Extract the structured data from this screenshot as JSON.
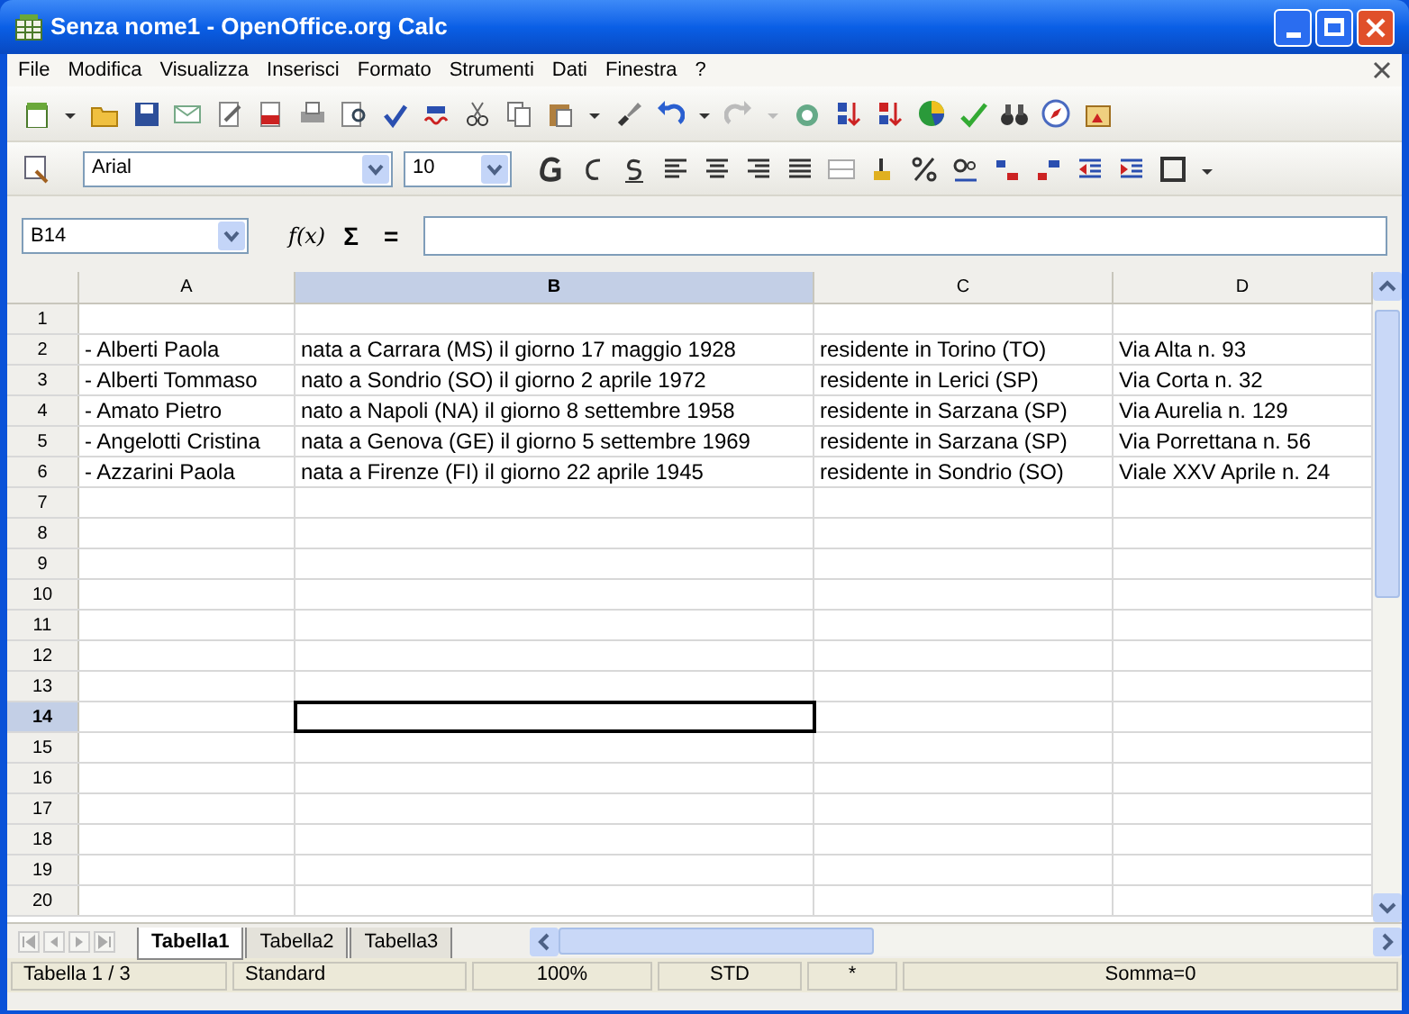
{
  "window": {
    "title": "Senza nome1 - OpenOffice.org Calc"
  },
  "menu": [
    "File",
    "Modifica",
    "Visualizza",
    "Inserisci",
    "Formato",
    "Strumenti",
    "Dati",
    "Finestra",
    "?"
  ],
  "formatting": {
    "font": "Arial",
    "size": "10"
  },
  "formula_bar": {
    "cell_ref": "B14",
    "function_symbol": "f(x)",
    "sum_symbol": "Σ",
    "equals_symbol": "="
  },
  "sheet": {
    "columns": [
      {
        "label": "A",
        "selected": false
      },
      {
        "label": "B",
        "selected": true
      },
      {
        "label": "C",
        "selected": false
      },
      {
        "label": "D",
        "selected": false
      }
    ],
    "rows": [
      {
        "header": "1",
        "selected": false
      },
      {
        "header": "2",
        "selected": false,
        "cells": [
          "- Alberti Paola",
          "nata a Carrara (MS) il giorno 17 maggio 1928",
          "residente in Torino (TO)",
          "Via Alta n. 93"
        ]
      },
      {
        "header": "3",
        "selected": false,
        "cells": [
          "- Alberti Tommaso",
          "nato a Sondrio (SO) il giorno 2 aprile 1972",
          "residente in Lerici (SP)",
          "Via Corta n. 32"
        ]
      },
      {
        "header": "4",
        "selected": false,
        "cells": [
          "- Amato Pietro",
          "nato a Napoli (NA) il giorno 8 settembre 1958",
          "residente in Sarzana (SP)",
          "Via Aurelia n. 129"
        ]
      },
      {
        "header": "5",
        "selected": false,
        "cells": [
          "- Angelotti Cristina",
          "nata a Genova (GE) il giorno 5 settembre 1969",
          "residente in Sarzana (SP)",
          "Via Porrettana n. 56"
        ]
      },
      {
        "header": "6",
        "selected": false,
        "cells": [
          "- Azzarini Paola",
          "nata a Firenze (FI) il giorno 22 aprile 1945",
          "residente in Sondrio (SO)",
          "Viale XXV Aprile n. 24"
        ]
      },
      {
        "header": "7",
        "selected": false
      },
      {
        "header": "8",
        "selected": false
      },
      {
        "header": "9",
        "selected": false
      },
      {
        "header": "10",
        "selected": false
      },
      {
        "header": "11",
        "selected": false
      },
      {
        "header": "12",
        "selected": false
      },
      {
        "header": "13",
        "selected": false
      },
      {
        "header": "14",
        "selected": true
      },
      {
        "header": "15",
        "selected": false
      },
      {
        "header": "16",
        "selected": false
      },
      {
        "header": "17",
        "selected": false
      },
      {
        "header": "18",
        "selected": false
      },
      {
        "header": "19",
        "selected": false
      },
      {
        "header": "20",
        "selected": false
      }
    ]
  },
  "sheet_tabs": [
    {
      "label": "Tabella1",
      "selected": true
    },
    {
      "label": "Tabella2",
      "selected": false
    },
    {
      "label": "Tabella3",
      "selected": false
    }
  ],
  "status_bar": [
    "Tabella 1 / 3",
    "Standard",
    "100%",
    "STD",
    "*",
    "Somma=0"
  ]
}
